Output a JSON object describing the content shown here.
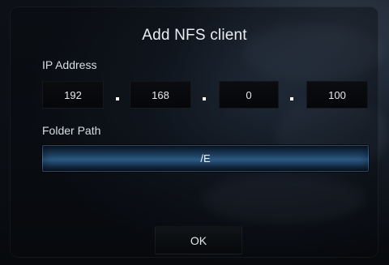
{
  "dialog": {
    "title": "Add NFS client",
    "ip_address": {
      "label": "IP Address",
      "octets": [
        "192",
        "168",
        "0",
        "100"
      ]
    },
    "folder_path": {
      "label": "Folder Path",
      "value": "/E"
    },
    "ok_label": "OK"
  },
  "colors": {
    "text": "#e9eef3",
    "field_bg": "#07080b",
    "path_highlight": "#2d5a83"
  }
}
